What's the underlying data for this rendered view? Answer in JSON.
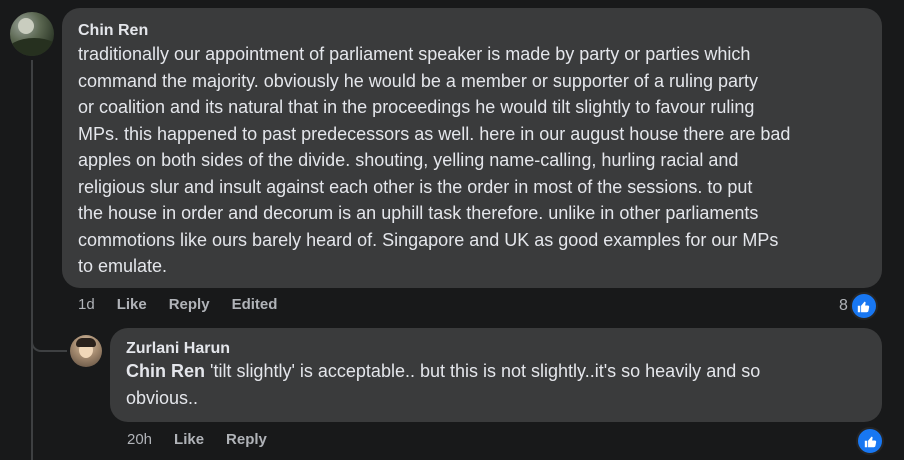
{
  "comment": {
    "author": "Chin Ren",
    "text": "traditionally our appointment of parliament speaker is made by party or parties which\ncommand the majority. obviously he would be a member or supporter of a ruling party\nor coalition and its natural that in the proceedings he would tilt slightly to favour ruling\nMPs. this happened to past predecessors as well. here in our august house there are bad\napples on both sides of the divide. shouting, yelling name-calling, hurling racial and\nreligious slur and insult against each other is the order in most of the sessions. to put\nthe house in order and decorum is an uphill task therefore. unlike in other parliaments\ncommotions like ours barely heard of. Singapore and UK as good examples for our MPs\nto emulate.",
    "time": "1d",
    "like_label": "Like",
    "reply_label": "Reply",
    "edited_label": "Edited",
    "reaction_count": "8",
    "reaction_icon": "like-icon"
  },
  "reply": {
    "author": "Zurlani Harun",
    "mention": "Chin Ren",
    "text": " 'tilt slightly' is acceptable.. but this is not slightly..it's so heavily and so\nobvious..",
    "time": "20h",
    "like_label": "Like",
    "reply_label": "Reply",
    "reaction_icon": "like-icon"
  },
  "colors": {
    "background": "#18191a",
    "bubble": "#3a3b3c",
    "text": "#e4e6eb",
    "secondary_text": "#b0b3b8",
    "like_blue": "#1877f2"
  }
}
